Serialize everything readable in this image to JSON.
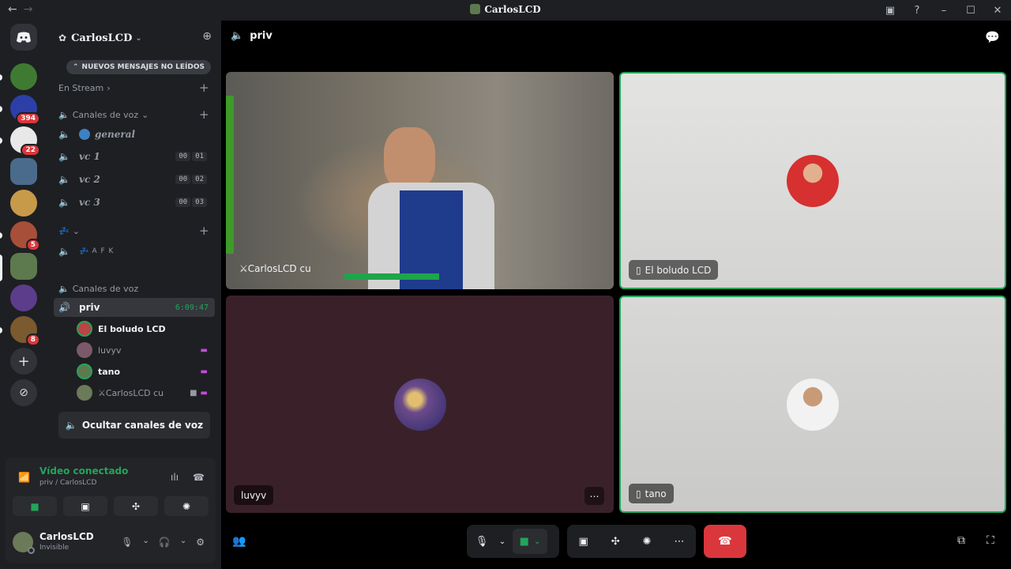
{
  "window": {
    "title": "CarlosLCD",
    "back_icon": "arrow-left-icon",
    "forward_icon": "arrow-right-icon"
  },
  "server": {
    "name": "CarlosLCD",
    "unread_banner": "NUEVOS MENSAJES NO LEÍDOS",
    "categories": {
      "stream": "En Stream",
      "voice1": "Canales de voz",
      "voice2": "Canales de voz"
    },
    "channels": [
      {
        "name": "general",
        "counts": []
      },
      {
        "name": "vc 1",
        "counts": [
          "00",
          "01"
        ]
      },
      {
        "name": "vc 2",
        "counts": [
          "00",
          "02"
        ]
      },
      {
        "name": "vc 3",
        "counts": [
          "00",
          "03"
        ]
      },
      {
        "name": "A F K",
        "counts": []
      }
    ],
    "active_channel": {
      "name": "priv",
      "timer": "6:09:47"
    },
    "members": [
      "El boludo LCD",
      "luvyv",
      "tano",
      "⚔CarlosLCD cu"
    ],
    "hide_voice": "Ocultar canales de voz"
  },
  "rail": {
    "badges": [
      "394",
      "22",
      "5",
      "8"
    ],
    "add_label": "+",
    "discover_label": "⊘"
  },
  "voice_panel": {
    "status": "Vídeo conectado",
    "location": "priv / CarlosLCD"
  },
  "user": {
    "name": "CarlosLCD",
    "status": "Invisible"
  },
  "main": {
    "channel": "priv",
    "tiles": [
      {
        "label": "⚔CarlosLCD cu"
      },
      {
        "label": "El boludo LCD"
      },
      {
        "label": "luvyv"
      },
      {
        "label": "tano"
      }
    ]
  },
  "colors": {
    "accent_green": "#23a55a",
    "danger_red": "#da373c",
    "tile_purple": "#3a2129",
    "tile_light": "#dcdcda"
  }
}
